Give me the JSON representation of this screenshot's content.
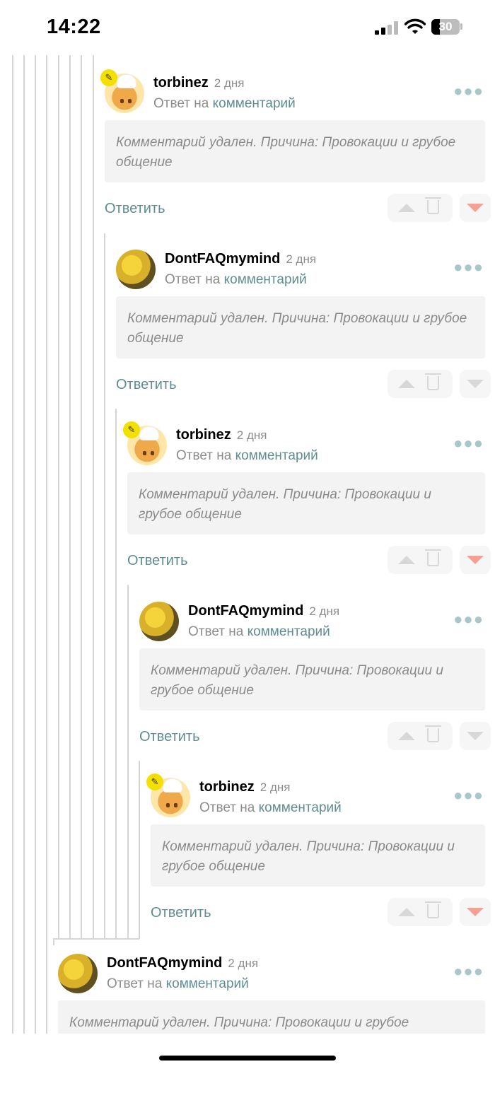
{
  "status_bar": {
    "time": "14:22",
    "battery": "30"
  },
  "comments": [
    {
      "author": "torbinez",
      "time_ago": "2 дня",
      "reply_prefix": "Ответ на",
      "reply_link": "комментарий",
      "body": "Комментарий удален. Причина: Провокации и грубое общение",
      "reply_label": "Ответить",
      "avatar": "cheese-chef",
      "badge_icon": "edit-icon",
      "vote": "down"
    },
    {
      "author": "DontFAQmymind",
      "time_ago": "2 дня",
      "reply_prefix": "Ответ на",
      "reply_link": "комментарий",
      "body": "Комментарий удален. Причина: Провокации и грубое общение",
      "reply_label": "Ответить",
      "avatar": "yellow-pattern",
      "vote": "none"
    },
    {
      "author": "torbinez",
      "time_ago": "2 дня",
      "reply_prefix": "Ответ на",
      "reply_link": "комментарий",
      "body": "Комментарий удален. Причина: Провокации и грубое общение",
      "reply_label": "Ответить",
      "avatar": "cheese-chef",
      "badge_icon": "edit-icon",
      "vote": "down"
    },
    {
      "author": "DontFAQmymind",
      "time_ago": "2 дня",
      "reply_prefix": "Ответ на",
      "reply_link": "комментарий",
      "body": "Комментарий удален. Причина: Провокации и грубое общение",
      "reply_label": "Ответить",
      "avatar": "yellow-pattern",
      "vote": "none"
    },
    {
      "author": "torbinez",
      "time_ago": "2 дня",
      "reply_prefix": "Ответ на",
      "reply_link": "комментарий",
      "body": "Комментарий удален. Причина: Провокации и грубое общение",
      "reply_label": "Ответить",
      "avatar": "cheese-chef",
      "badge_icon": "edit-icon",
      "vote": "down"
    },
    {
      "author": "DontFAQmymind",
      "time_ago": "2 дня",
      "reply_prefix": "Ответ на",
      "reply_link": "комментарий",
      "body": "Комментарий удален. Причина: Провокации и грубое",
      "avatar": "yellow-pattern"
    }
  ],
  "colors": {
    "accent": "#5f8d91",
    "downvote_active": "#f6a093",
    "badge": "#f4e000",
    "body_bg": "#f3f3f3"
  }
}
